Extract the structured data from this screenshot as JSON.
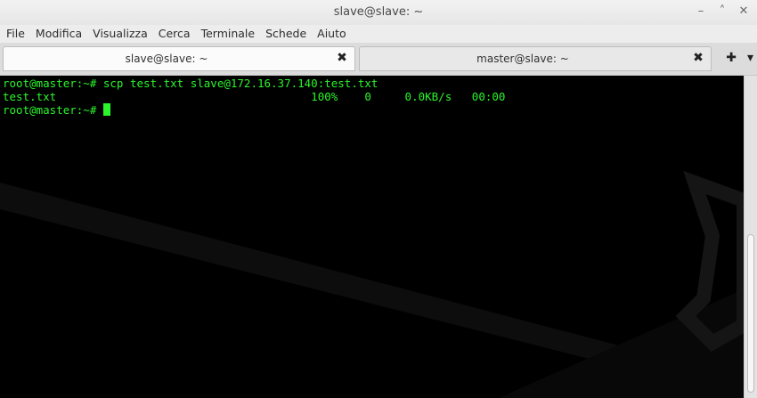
{
  "window": {
    "title": "slave@slave: ~",
    "minimize_icon": "–",
    "maximize_icon": "˄",
    "close_icon": "✕"
  },
  "menu": [
    "File",
    "Modifica",
    "Visualizza",
    "Cerca",
    "Terminale",
    "Schede",
    "Aiuto"
  ],
  "tabs": [
    {
      "label": "slave@slave: ~",
      "active": true
    },
    {
      "label": "master@slave: ~",
      "active": false
    }
  ],
  "tab_close_icon": "✖",
  "tab_actions": {
    "add_icon": "✚",
    "menu_icon": "▾"
  },
  "terminal": {
    "text_color": "#2bf52b",
    "lines": [
      "root@master:~# scp test.txt slave@172.16.37.140:test.txt",
      "test.txt                                      100%    0     0.0KB/s   00:00",
      "root@master:~# "
    ]
  }
}
